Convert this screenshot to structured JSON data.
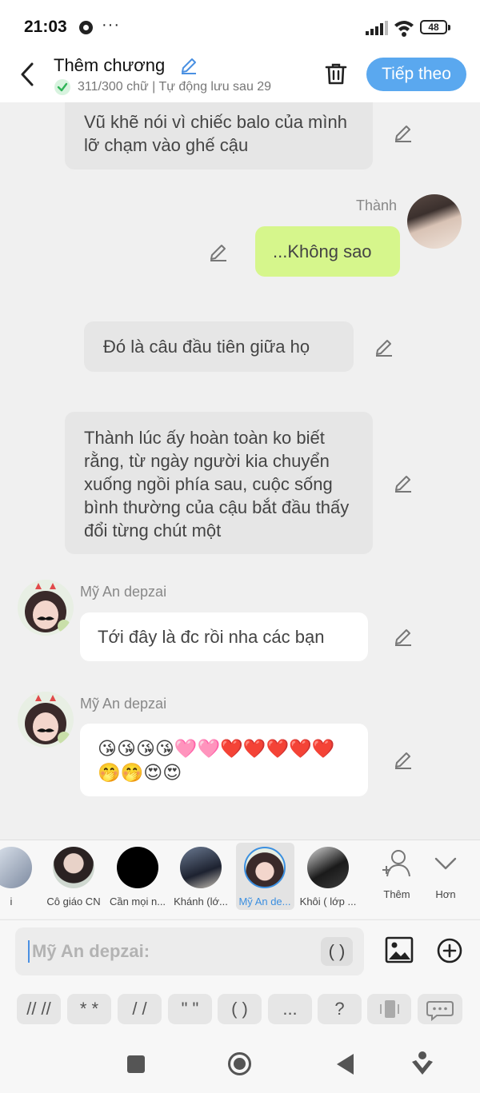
{
  "status_bar": {
    "time": "21:03",
    "dots": "···",
    "battery": "48"
  },
  "header": {
    "title": "Thêm chương",
    "subtitle": "311/300 chữ | Tự động lưu sau 29",
    "next_label": "Tiếp theo"
  },
  "messages": [
    {
      "type": "narration",
      "text": "Vũ khẽ nói vì chiếc balo của mình lỡ chạm vào ghế cậu"
    },
    {
      "type": "character",
      "speaker": "Thành",
      "text": "...Không sao"
    },
    {
      "type": "narration",
      "text": "Đó là câu đầu tiên giữa họ"
    },
    {
      "type": "narration",
      "text": "Thành lúc ấy hoàn toàn ko biết rằng, từ ngày người kia chuyển xuống ngồi phía sau, cuộc sống bình thường của cậu bắt đầu thấy đổi từng chút một"
    },
    {
      "type": "character",
      "speaker": "Mỹ An depzai",
      "text": "Tới đây là đc rồi nha các bạn"
    },
    {
      "type": "character",
      "speaker": "Mỹ An depzai",
      "text": "😘😘😘😘🩷🩷❤️❤️❤️❤️❤️🤭🤭😍😍"
    }
  ],
  "characters": [
    {
      "label": "i"
    },
    {
      "label": "Cô giáo CN"
    },
    {
      "label": "Cần mọi n..."
    },
    {
      "label": "Khánh (lớ..."
    },
    {
      "label": "Mỹ An de...",
      "selected": true
    },
    {
      "label": "Khôi ( lớp ..."
    }
  ],
  "character_actions": {
    "add_label": "Thêm",
    "more_label": "Hơn"
  },
  "input": {
    "placeholder": "Mỹ An depzai:",
    "paren_button": "( )"
  },
  "quick_keys": [
    "// //",
    "* *",
    "/ /",
    "\" \"",
    "( )",
    "...",
    "?"
  ],
  "colors": {
    "accent": "#5aa8ef",
    "own_bubble": "#d6f68c",
    "selected_char_label": "#3b8fe0"
  }
}
